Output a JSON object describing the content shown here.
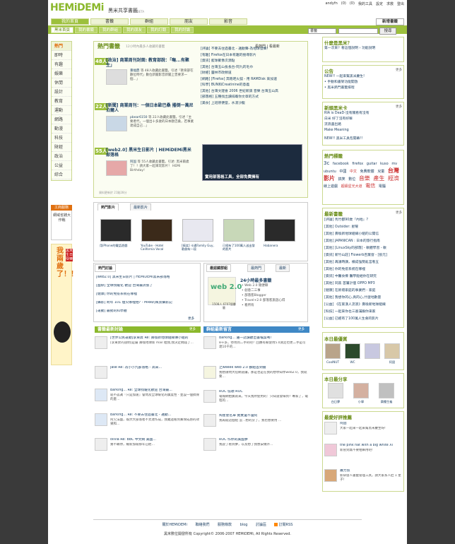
{
  "header": {
    "logo": "HEMiDEMi",
    "logo_sub": "黑米共享書籤",
    "beta": "BETA",
    "toplinks": [
      "andyfn",
      "(0)",
      "(0)",
      "我的工具",
      "設定",
      "求救",
      "登出"
    ],
    "add_bookmark": "新增書籤"
  },
  "tabs": [
    "書籤",
    "群組",
    "朋友",
    "影音"
  ],
  "my_home": "我的首頁",
  "subnav": [
    "黑米首頁",
    "我的書籤",
    "我的群組",
    "我的朋友",
    "我的訂閱",
    "我的討論"
  ],
  "search": {
    "select": "書籤",
    "button": "搜尋"
  },
  "categories": {
    "head": "熱門",
    "items": [
      "即時",
      "有趣",
      "娛樂",
      "休閒",
      "設計",
      "教育",
      "運動",
      "網路",
      "動漫",
      "科技",
      "財經",
      "政治",
      "公益",
      "綜合"
    ]
  },
  "hot": {
    "title": "熱門書籤",
    "subtitle": "12小時內最多人收藏的書籤",
    "link_hot": "看熱門",
    "link_new": "看最新",
    "update": "資料更新於 21點28分",
    "stories": [
      {
        "num": "48人",
        "title": "[政治] 商業周刊封面: 教育部說：「嘸...有聚生」",
        "user": "重福鼎",
        "meta": "等 48人收藏此書籤。引述『教育部在數位時代」數位新聞影音新聞上曾要求一個...」"
      },
      {
        "num": "22人",
        "title": "[新聞] 商業周刊：一個日本歐巴桑 撂倒一萬尼泊爾人",
        "user": "pbear6150",
        "meta": "等 22人收藏此書籤。引述『主要者代，一個出十多歲的日本歐巴桑，若事業達成自己...」"
      },
      {
        "num": "55人",
        "title": "[web2.0] 黑米生日影片 | HEMiDEMi黑米部落格",
        "user": "阿固",
        "meta": "等 55人收藏此書籤。引述: 黑米兩歲了！！請大家一起來玩影片！ HEMi Birthday!"
      }
    ],
    "right_list": [
      "[評論] 不要去住過臺北 - 邁動聲-為地球發聲！",
      "[有趣] Firefox在日本有趣的搜尋影片",
      "[資訊] 藍球聚像次源點",
      "[其他] 台灣玉山長長台-阿九的毛巾",
      "[財經] 靈林市政頻道",
      "[網路] [Firefox] 奔跑吧火狐 - 用 RAMDisk 來加速",
      "[科學] BUN和Creatinine的意義",
      "[其他] 台灣文建會 2006 世紀新調 音樂 台灣玉山高",
      "[部落格] 五種找出讀排廟你文章的方式",
      "[美食] 上班帶便當，水漾沙龍"
    ],
    "ad_label": "工商服務",
    "ad_text": "實用部落格工具，全部免費擁有"
  },
  "left_ad": {
    "head": "工商服務",
    "text": "網域省錢大作戰"
  },
  "bday": {
    "big": "我兩歲了！！",
    "small": "黑米生日快樂"
  },
  "videos": {
    "tabs": [
      "熱門影片",
      "最新影片"
    ],
    "items": [
      {
        "caption": "用iPhone的電話遊戲"
      },
      {
        "caption": "YouTube - Hotel California Vocal"
      },
      {
        "caption": "[搞笑] 卡通Family Guy, 歌劇有一段"
      },
      {
        "caption": "已經有了100萬人送出發的影片"
      },
      {
        "caption": "Habanera"
      }
    ]
  },
  "discussion": {
    "tab": "熱門討論",
    "items": [
      "[web2.0] 黑米生日影片 | HEMiDEMi黑米部落格",
      "[國際] 全球找暖化 歡迎 台灣最誇張了",
      "[健康] 你的免疫系統在哪裡",
      "[攝影] 跨年 101 煙火哪裡拍? - Mike的風景攝影記",
      "[運動] 最勁的科學體"
    ],
    "more": "更多"
  },
  "bookmarks_box": {
    "tabs": [
      "最認藏群組",
      "最熱門",
      "最新"
    ],
    "badge": "web 2.0",
    "meta": "1508人 6707個書籤",
    "title": "24小時最多書籤",
    "items": [
      "• Web 2.0 隨便聊",
      "• 創意二三事",
      "• 部落客Blogger",
      "• Travel+2.0 部落客旅遊心得",
      "• 看所有"
    ]
  },
  "book_discussion": {
    "bar": "書籤最新討論",
    "more": "更多",
    "items": [
      {
        "title": "[世界公民運動]李東昇 Re: 壽喚新地球組織傳小組的",
        "desc": "[李東昇的說明]是屬 壽喚地球新 mail 給我,我決定捐錢了…"
      },
      {
        "title": "jase Re: 為小小九部落格 - 高來...",
        "desc": ""
      },
      {
        "title": "Barking... Re: 全球找暖化歡迎 台灣最...",
        "desc": "就不認識『只是加速』會問及全球暖化的廣度性 - 並設一個搞保的麼…"
      },
      {
        "title": "Barking... Re: 不要去住過臺北 - 邁動...",
        "desc": "阿欠法國，既然大部落者不太達作成，我難過看到賓保成感的效果和..."
      },
      {
        "title": "olivia Re: BBC 中文網 美國...",
        "desc": "實不瞞你，繼新加坡那年已經…"
      }
    ]
  },
  "group_msgs": {
    "bar": "群組最新留言",
    "more": "更多",
    "items": [
      {
        "title": "Barking... 邊一誌讀聽出書檔案嗎！",
        "desc": "8千多，停用到二手的吧？回應有被使用5.0測定也更二手是可達10千的…"
      },
      {
        "title": "之weeek web 2.0 群組首到播",
        "desc": "我想請問大陸網道讓，那是也是在我的想學知學web2.0，我就要…"
      },
      {
        "title": "ROC 低收-ROC",
        "desc": "電報網拍賣就來。今天我所使用的：只知道發綠到？專家了，電程的…"
      },
      {
        "title": "陶星星名單 拋棄還不還阿",
        "desc": "我再開這個帖 沒…想的分了，我也想要用 …"
      },
      {
        "title": "ROC 作你的美國夢",
        "desc": "我說了看到夢，以及想了我想安做外…"
      }
    ]
  },
  "right": {
    "what_title": "什麼是黑米？",
    "what_lines": [
      "第一次來？看這個說明 › 功能說明"
    ],
    "notice_title": "公告",
    "notice_more": "更多",
    "notice_lines": [
      "NEW!! 一起來幫黑米慶生!",
      "• 手動和書架功能開放",
      "• 黑米熱門書籤排程"
    ],
    "new_title": "新頭黑米卡",
    "new_more": "更多",
    "new_lines": [
      "RIA is DeaD-沒有關看有沒有",
      "白米 好了沒有好嘛",
      "流浪盡出路",
      "Make Meaning",
      "NEW!! 黑米工具包開幕!!"
    ],
    "tags_title": "熱門標籤",
    "tags": [
      "3c",
      "facebook",
      "firefox",
      "guitar",
      "kuso",
      "mv",
      "ubuntu",
      "中國",
      "中文",
      "免費軟體",
      "兒童",
      "台灣",
      "影片",
      "搞笑",
      "數位",
      "音樂",
      "產生",
      "經濟",
      "線上遊戲",
      "超級星光大道",
      "電信",
      "電腦"
    ],
    "latest_title": "最新書籤",
    "latest_more": "更多",
    "latest_lines": [
      "[評論] 馬竹都90歲『內地』?",
      "[其他] Outsider: 星曜",
      "[其他] 壽喚新地球組織小組的公開信",
      "[其他] JAPANICAN : 日本的旅行指南",
      "[其他] [LinuxSky的部落] - 軟體學習 - 軟",
      "[資訊] 新竹山莊] Flowerb百葉窗 - [張元]",
      "[其他] 再議時講，橫成強勢亂宮看五",
      "[其他] 你的免疫系統在哪裡",
      "[資訊] 中醫食療 醫學能給你在研究",
      "[其他] 同黑 首屬計個 OPPO MP3",
      "[健康] 在新壇家庭的事業們 - 家庭",
      "[其他] 我想你的心,真的心,什麼地數量",
      "[公益] 《在家漢人流浪》壽喚新地球組織",
      "[科技] 一起來你也三基滿跟你來家",
      "[公益] 已經有了100萬人生會的影片"
    ],
    "daily_user_title": "本日最優質",
    "daily_users": [
      "CooINUT",
      "WC",
      "",
      "阿固"
    ],
    "daily_share_title": "本日最分享",
    "daily_shares": [
      "白日夢",
      "小寧",
      "樂種生龜"
    ],
    "recommend_title": "最愛好評推薦",
    "recommend_more": "更多",
    "recommends": [
      {
        "name": "阿固",
        "text": "大家一起來一起來幫黑米慶生呀!"
      },
      {
        "name": "the pink hat with a big white XI",
        "text": "新管到無不要相嘛用吧!"
      },
      {
        "name": "蕭力叔",
        "text": "新研發人書籤管理工具，請大家系人肚 1 星子！"
      }
    ]
  },
  "footer": {
    "links": [
      "關於HEMiDEMi",
      "聯絡我們",
      "服務條款",
      "blog",
      "討論區",
      "訂閱RSS"
    ],
    "copy": "黑米數位開發所有 Copyright© 2006-2007 HEMiDEMi, All Rights Reserved."
  }
}
